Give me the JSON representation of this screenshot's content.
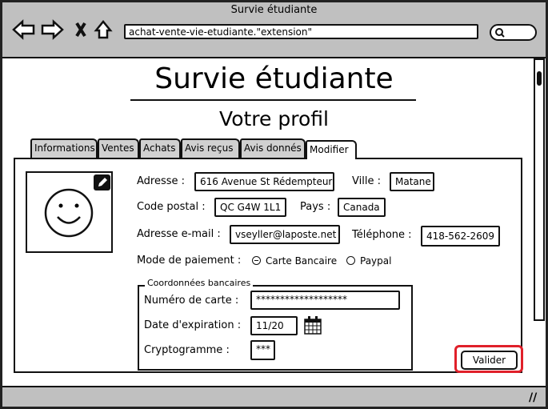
{
  "browser": {
    "title": "Survie étudiante",
    "url": "achat-vente-vie-etudiante.\"extension\"",
    "icons": [
      "back-arrow-icon",
      "forward-arrow-icon",
      "close-x-icon",
      "home-icon",
      "search-icon"
    ]
  },
  "page": {
    "heading": "Survie étudiante",
    "subtitle": "Votre profil"
  },
  "tabs": [
    {
      "label": "Informations"
    },
    {
      "label": "Ventes"
    },
    {
      "label": "Achats"
    },
    {
      "label": "Avis reçus"
    },
    {
      "label": "Avis donnés"
    },
    {
      "label": "Modifier",
      "active": true
    }
  ],
  "form": {
    "address_label": "Adresse :",
    "address": "616 Avenue St Rédempteur",
    "city_label": "Ville :",
    "city": "Matane",
    "postal_label": "Code postal :",
    "postal": "QC G4W 1L1",
    "country_label": "Pays :",
    "country": "Canada",
    "email_label": "Adresse e-mail :",
    "email": "vseyller@laposte.net",
    "phone_label": "Téléphone :",
    "phone": "418-562-2609",
    "payment_label": "Mode de paiement :",
    "payment_options": [
      {
        "label": "Carte Bancaire",
        "selected": true
      },
      {
        "label": "Paypal",
        "selected": false
      }
    ],
    "bank": {
      "legend": "Coordonnées bancaires",
      "card_label": "Numéro de carte :",
      "card": "*******************",
      "expiry_label": "Date d'expiration :",
      "expiry": "11/20",
      "cvv_label": "Cryptogramme :",
      "cvv": "***"
    },
    "submit": "Valider"
  },
  "colors": {
    "chrome": "#c0c0c0",
    "highlight": "#e0202a"
  }
}
